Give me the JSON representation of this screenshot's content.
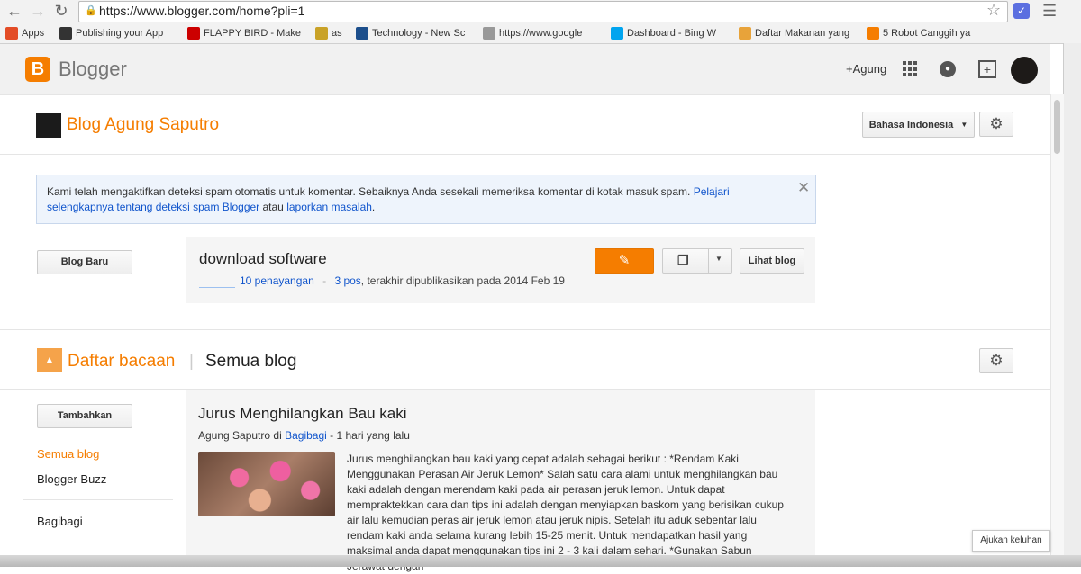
{
  "browser": {
    "url": "https://www.blogger.com/home?pli=1",
    "bookmarks": [
      {
        "label": "Apps",
        "icon": "apps-grid-icon",
        "color": "#e34c26"
      },
      {
        "label": "Publishing your App",
        "icon": "publishing-icon",
        "color": "#333333"
      },
      {
        "label": "FLAPPY BIRD - Make",
        "icon": "youtube-icon",
        "color": "#cc0000"
      },
      {
        "label": "as",
        "icon": "yandex-icon",
        "color": "#c9a227"
      },
      {
        "label": "Technology - New Sc",
        "icon": "ns-icon",
        "color": "#1c4f8c"
      },
      {
        "label": "https://www.google",
        "icon": "page-icon",
        "color": "#999999"
      },
      {
        "label": "Dashboard - Bing W",
        "icon": "microsoft-icon",
        "color": "#00a4ef"
      },
      {
        "label": "Daftar Makanan yang",
        "icon": "page-orange-icon",
        "color": "#e8a33a"
      },
      {
        "label": "5 Robot Canggih ya",
        "icon": "blogger-icon",
        "color": "#f57d00"
      }
    ]
  },
  "header": {
    "brand": "Blogger",
    "brand_color": "#f57d00",
    "user_link": "+Agung"
  },
  "blog": {
    "title": "Blog Agung Saputro",
    "language": "Bahasa Indonesia"
  },
  "notice": {
    "text": "Kami telah mengaktifkan deteksi spam otomatis untuk komentar. Sebaiknya Anda sesekali memeriksa komentar di kotak masuk spam. ",
    "link1": "Pelajari selengkapnya tentang deteksi spam Blogger",
    "middle": " atau ",
    "link2": "laporkan masalah",
    "end": "."
  },
  "new_blog_button": "Blog Baru",
  "blog_card": {
    "title": "download software",
    "views": "10 penayangan",
    "separator": "-",
    "posts": "3 pos",
    "last_published": ", terakhir dipublikasikan pada 2014 Feb 19",
    "view_button": "Lihat blog"
  },
  "reading_list": {
    "title": "Daftar bacaan",
    "separator": "|",
    "filter": "Semua blog",
    "add_button": "Tambahkan",
    "side_items": [
      "Semua blog",
      "Blogger Buzz",
      "Bagibagi"
    ]
  },
  "post": {
    "title": "Jurus Menghilangkan Bau kaki",
    "author": "Agung Saputro",
    "in": "di",
    "blog": "Bagibagi",
    "time": "- 1 hari yang lalu",
    "body": "Jurus menghilangkan bau kaki yang cepat adalah sebagai berikut : *Rendam Kaki Menggunakan Perasan Air Jeruk Lemon* Salah satu cara alami untuk menghilangkan bau kaki adalah dengan merendam kaki pada air perasan jeruk lemon. Untuk dapat mempraktekkan cara dan tips ini adalah dengan menyiapkan baskom yang berisikan cukup air lalu kemudian peras air jeruk lemon atau jeruk nipis. Setelah itu aduk sebentar lalu rendam kaki anda selama kurang lebih 15-25 menit. Untuk mendapatkan hasil yang maksimal anda dapat menggunakan tips ini 2 - 3 kali dalam sehari. *Gunakan Sabun Jerawat dengan"
  },
  "feedback_button": "Ajukan keluhan"
}
